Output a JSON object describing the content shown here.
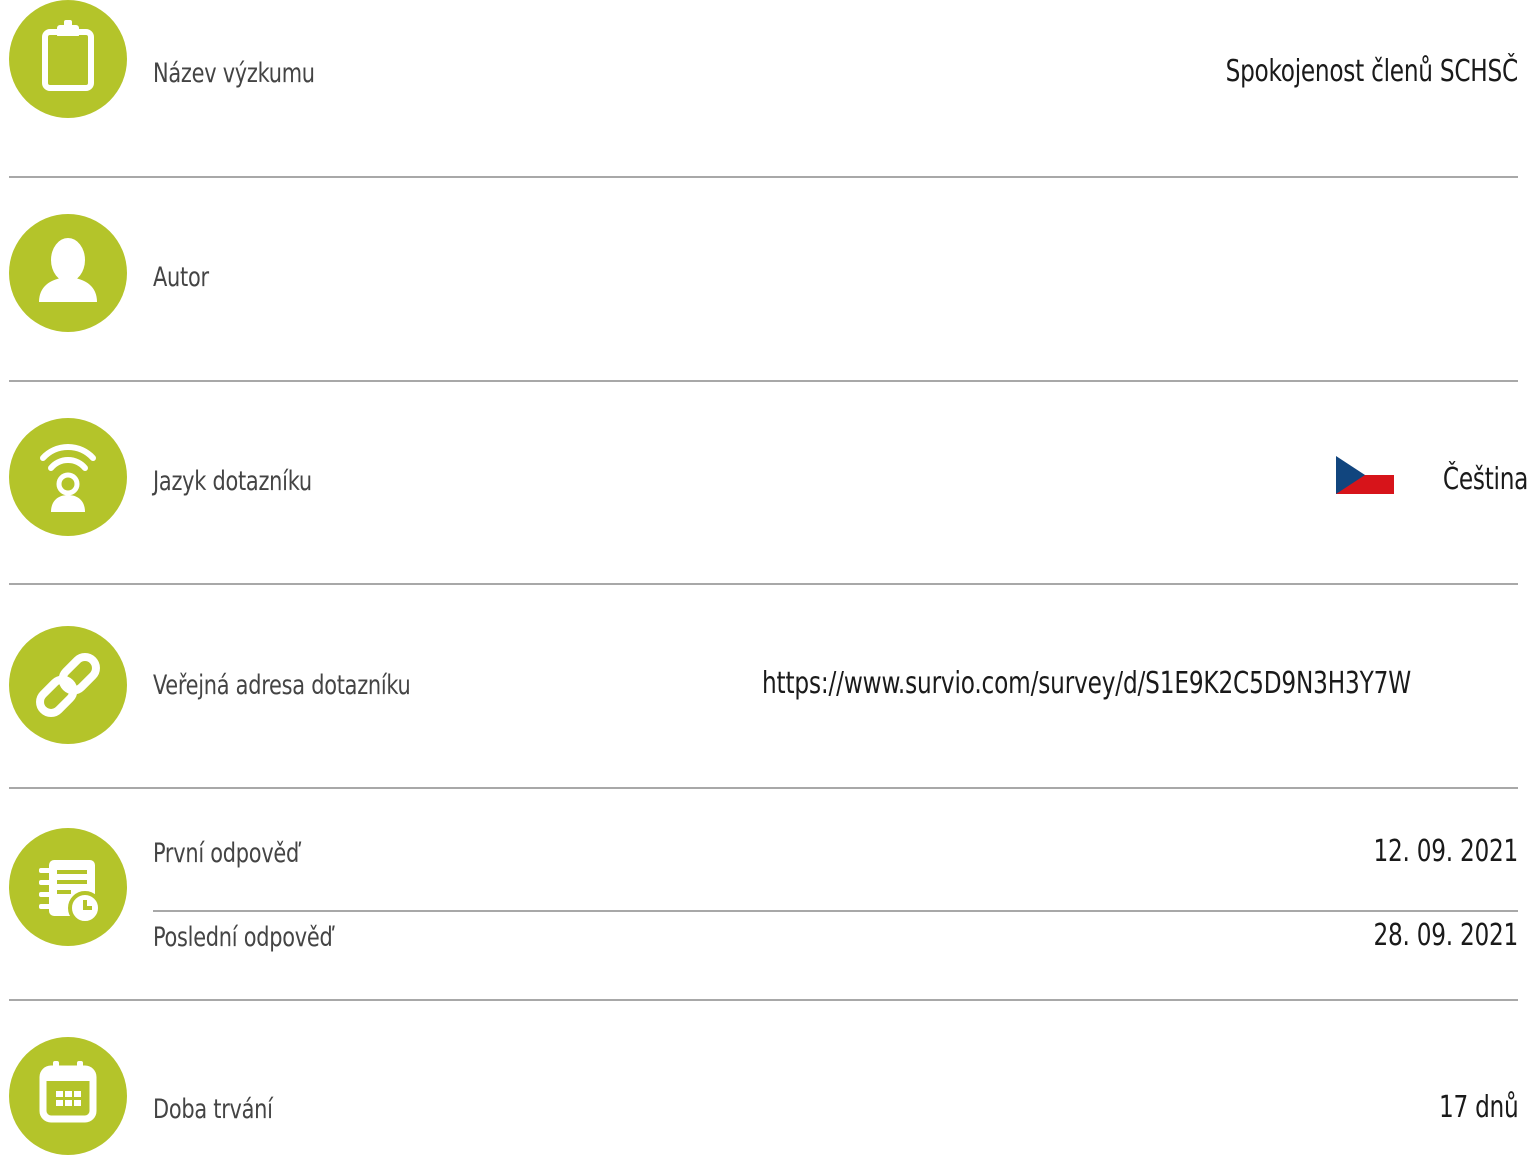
{
  "colors": {
    "accent": "#b4c42a",
    "divider": "#a8a8a8",
    "label": "#444444",
    "value": "#1a1a1a",
    "flag_white": "#ffffff",
    "flag_red": "#d7141a",
    "flag_blue": "#11457e"
  },
  "rows": {
    "title": {
      "icon": "clipboard-icon",
      "label": "Název výzkumu",
      "value": "Spokojenost členů SCHSČ"
    },
    "author": {
      "icon": "person-icon",
      "label": "Autor",
      "value": ""
    },
    "language": {
      "icon": "broadcast-person-icon",
      "label": "Jazyk dotazníku",
      "value": "Čeština",
      "flag_icon": "czech-flag-icon"
    },
    "url": {
      "icon": "link-icon",
      "label": "Veřejná adresa dotazníku",
      "value": "https://www.survio.com/survey/d/S1E9K2C5D9N3H3Y7W"
    },
    "responses": {
      "icon": "schedule-document-icon",
      "first_label": "První odpověď",
      "first_value": "12. 09. 2021",
      "last_label": "Poslední odpověď",
      "last_value": "28. 09. 2021"
    },
    "duration": {
      "icon": "calendar-icon",
      "label": "Doba trvání",
      "value": "17 dnů"
    }
  }
}
